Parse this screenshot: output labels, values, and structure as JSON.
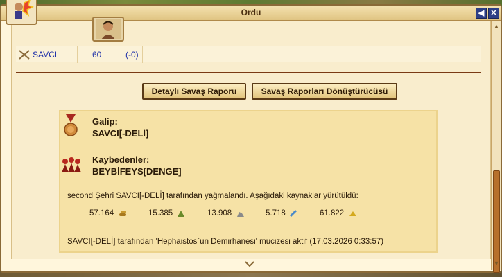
{
  "window": {
    "title": "Ordu"
  },
  "titlebar_buttons": {
    "back": "◀",
    "close": "✕"
  },
  "table": {
    "player": "SAVCI",
    "count": "60",
    "loss": "(-0)"
  },
  "buttons": {
    "detailed_report": "Detaylı Savaş Raporu",
    "converter": "Savaş Raporları Dönüştürücüsü"
  },
  "report": {
    "winner_label": "Galip:",
    "winner_name": "SAVCI[-DELİ]",
    "losers_label": "Kaybedenler:",
    "losers_name": "BEYBİFEYS[DENGE]",
    "plunder_text": "second Şehri SAVCI[-DELİ] tarafından yağmalandı. Aşağıdaki kaynaklar yürütüldü:",
    "resources": [
      {
        "value": "57.164",
        "icon": "wood-icon",
        "color": "#a8791e"
      },
      {
        "value": "15.385",
        "icon": "clay-icon",
        "color": "#6a8a2a"
      },
      {
        "value": "13.908",
        "icon": "iron-icon",
        "color": "#8a8a8a"
      },
      {
        "value": "5.718",
        "icon": "crop-icon",
        "color": "#4a8ac8"
      },
      {
        "value": "61.822",
        "icon": "gold-icon",
        "color": "#d4a91e"
      }
    ],
    "wonder_text": "SAVCI[-DELİ] tarafından 'Hephaistos`un Demirhanesi' mucizesi aktif (17.03.2026 0:33:57)"
  }
}
